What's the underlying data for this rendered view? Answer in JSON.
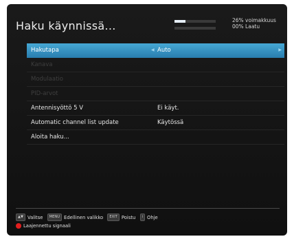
{
  "header": {
    "title": "Haku käynnissä...",
    "strength_text": "26% voimakkuus",
    "quality_text": "00% Laatu",
    "strength_level_pct": 26,
    "quality_level_pct": 0
  },
  "menu": {
    "items": [
      {
        "label": "Hakutapa",
        "value": "Auto"
      },
      {
        "label": "Kanava",
        "value": ""
      },
      {
        "label": "Modulaatio",
        "value": ""
      },
      {
        "label": "PID-arvot",
        "value": ""
      },
      {
        "label": "Antennisyöttö 5 V",
        "value": "Ei käyt."
      },
      {
        "label": "Automatic channel list update",
        "value": "Käytössä"
      },
      {
        "label": "Aloita haku...",
        "value": ""
      }
    ]
  },
  "footer": {
    "nav_key": "▲▼",
    "nav_label": "Valitse",
    "menu_key": "MENU",
    "menu_label": "Edellinen valikko",
    "exit_key": "EXIT",
    "exit_label": "Poistu",
    "help_key": "i",
    "help_label": "Ohje",
    "red_label": "Laajennettu signaali"
  },
  "colors": {
    "selected_row": "#2f8ec0",
    "background": "#151515",
    "red_button": "#e21e1e"
  }
}
